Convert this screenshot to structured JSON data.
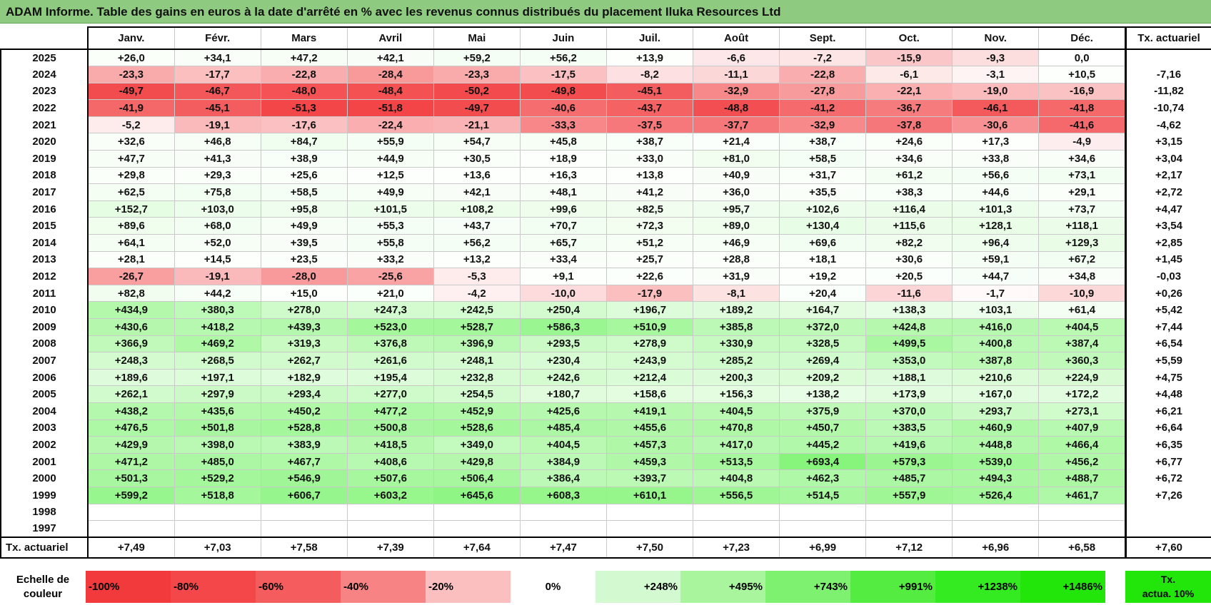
{
  "title": "ADAM Informe. Table des gains en euros à la date d'arrêté en % avec les revenus connus distribués du placement Iluka Resources Ltd",
  "months": [
    "Janv.",
    "Févr.",
    "Mars",
    "Avril",
    "Mai",
    "Juin",
    "Juil.",
    "Août",
    "Sept.",
    "Oct.",
    "Nov.",
    "Déc."
  ],
  "side_header": "Tx. actuariel",
  "rows": [
    {
      "year": "2025",
      "values": [
        "+26,0",
        "+34,1",
        "+47,2",
        "+42,1",
        "+59,2",
        "+56,2",
        "+13,9",
        "-6,6",
        "-7,2",
        "-15,9",
        "-9,3",
        "0,0"
      ],
      "rate": ""
    },
    {
      "year": "2024",
      "values": [
        "-23,3",
        "-17,7",
        "-22,8",
        "-28,4",
        "-23,3",
        "-17,5",
        "-8,2",
        "-11,1",
        "-22,8",
        "-6,1",
        "-3,1",
        "+10,5"
      ],
      "rate": "-7,16"
    },
    {
      "year": "2023",
      "values": [
        "-49,7",
        "-46,7",
        "-48,0",
        "-48,4",
        "-50,2",
        "-49,8",
        "-45,1",
        "-32,9",
        "-27,8",
        "-22,1",
        "-19,0",
        "-16,9"
      ],
      "rate": "-11,82"
    },
    {
      "year": "2022",
      "values": [
        "-41,9",
        "-45,1",
        "-51,3",
        "-51,8",
        "-49,7",
        "-40,6",
        "-43,7",
        "-48,8",
        "-41,2",
        "-36,7",
        "-46,1",
        "-41,8"
      ],
      "rate": "-10,74"
    },
    {
      "year": "2021",
      "values": [
        "-5,2",
        "-19,1",
        "-17,6",
        "-22,4",
        "-21,1",
        "-33,3",
        "-37,5",
        "-37,7",
        "-32,9",
        "-37,8",
        "-30,6",
        "-41,6"
      ],
      "rate": "-4,62"
    },
    {
      "year": "2020",
      "values": [
        "+32,6",
        "+46,8",
        "+84,7",
        "+55,9",
        "+54,7",
        "+45,8",
        "+38,7",
        "+21,4",
        "+38,7",
        "+24,6",
        "+17,3",
        "-4,9"
      ],
      "rate": "+3,15"
    },
    {
      "year": "2019",
      "values": [
        "+47,7",
        "+41,3",
        "+38,9",
        "+44,9",
        "+30,5",
        "+18,9",
        "+33,0",
        "+81,0",
        "+58,5",
        "+34,6",
        "+33,8",
        "+34,6"
      ],
      "rate": "+3,04"
    },
    {
      "year": "2018",
      "values": [
        "+29,8",
        "+29,3",
        "+25,6",
        "+12,5",
        "+13,6",
        "+16,3",
        "+13,8",
        "+40,9",
        "+31,7",
        "+61,2",
        "+56,6",
        "+73,1"
      ],
      "rate": "+2,17"
    },
    {
      "year": "2017",
      "values": [
        "+62,5",
        "+75,8",
        "+58,5",
        "+49,9",
        "+42,1",
        "+48,1",
        "+41,2",
        "+36,0",
        "+35,5",
        "+38,3",
        "+44,6",
        "+29,1"
      ],
      "rate": "+2,72"
    },
    {
      "year": "2016",
      "values": [
        "+152,7",
        "+103,0",
        "+95,8",
        "+101,5",
        "+108,2",
        "+99,6",
        "+82,5",
        "+95,7",
        "+102,6",
        "+116,4",
        "+101,3",
        "+73,7"
      ],
      "rate": "+4,47"
    },
    {
      "year": "2015",
      "values": [
        "+89,6",
        "+68,0",
        "+49,9",
        "+55,3",
        "+43,7",
        "+70,7",
        "+72,3",
        "+89,0",
        "+130,4",
        "+115,6",
        "+128,1",
        "+118,1"
      ],
      "rate": "+3,54"
    },
    {
      "year": "2014",
      "values": [
        "+64,1",
        "+52,0",
        "+39,5",
        "+55,8",
        "+56,2",
        "+65,7",
        "+51,2",
        "+46,9",
        "+69,6",
        "+82,2",
        "+96,4",
        "+129,3"
      ],
      "rate": "+2,85"
    },
    {
      "year": "2013",
      "values": [
        "+28,1",
        "+14,5",
        "+23,5",
        "+33,2",
        "+13,2",
        "+33,4",
        "+25,7",
        "+28,8",
        "+18,1",
        "+30,6",
        "+59,1",
        "+67,2"
      ],
      "rate": "+1,45"
    },
    {
      "year": "2012",
      "values": [
        "-26,7",
        "-19,1",
        "-28,0",
        "-25,6",
        "-5,3",
        "+9,1",
        "+22,6",
        "+31,9",
        "+19,2",
        "+20,5",
        "+44,7",
        "+34,8"
      ],
      "rate": "-0,03"
    },
    {
      "year": "2011",
      "values": [
        "+82,8",
        "+44,2",
        "+15,0",
        "+21,0",
        "-4,2",
        "-10,0",
        "-17,9",
        "-8,1",
        "+20,4",
        "-11,6",
        "-1,7",
        "-10,9"
      ],
      "rate": "+0,26"
    },
    {
      "year": "2010",
      "values": [
        "+434,9",
        "+380,3",
        "+278,0",
        "+247,3",
        "+242,5",
        "+250,4",
        "+196,7",
        "+189,2",
        "+164,7",
        "+138,3",
        "+103,1",
        "+61,4"
      ],
      "rate": "+5,42"
    },
    {
      "year": "2009",
      "values": [
        "+430,6",
        "+418,2",
        "+439,3",
        "+523,0",
        "+528,7",
        "+586,3",
        "+510,9",
        "+385,8",
        "+372,0",
        "+424,8",
        "+416,0",
        "+404,5"
      ],
      "rate": "+7,44"
    },
    {
      "year": "2008",
      "values": [
        "+366,9",
        "+469,2",
        "+319,3",
        "+376,8",
        "+396,9",
        "+293,5",
        "+278,9",
        "+330,9",
        "+328,5",
        "+499,5",
        "+400,8",
        "+387,4"
      ],
      "rate": "+6,54"
    },
    {
      "year": "2007",
      "values": [
        "+248,3",
        "+268,5",
        "+262,7",
        "+261,6",
        "+248,1",
        "+230,4",
        "+243,9",
        "+285,2",
        "+269,4",
        "+353,0",
        "+387,8",
        "+360,3"
      ],
      "rate": "+5,59"
    },
    {
      "year": "2006",
      "values": [
        "+189,6",
        "+197,1",
        "+182,9",
        "+195,4",
        "+232,8",
        "+242,6",
        "+212,4",
        "+200,3",
        "+209,2",
        "+188,1",
        "+210,6",
        "+224,9"
      ],
      "rate": "+4,75"
    },
    {
      "year": "2005",
      "values": [
        "+262,1",
        "+297,9",
        "+293,4",
        "+277,0",
        "+254,5",
        "+180,7",
        "+158,6",
        "+156,3",
        "+138,2",
        "+173,9",
        "+167,0",
        "+172,2"
      ],
      "rate": "+4,48"
    },
    {
      "year": "2004",
      "values": [
        "+438,2",
        "+435,6",
        "+450,2",
        "+477,2",
        "+452,9",
        "+425,6",
        "+419,1",
        "+404,5",
        "+375,9",
        "+370,0",
        "+293,7",
        "+273,1"
      ],
      "rate": "+6,21"
    },
    {
      "year": "2003",
      "values": [
        "+476,5",
        "+501,8",
        "+528,8",
        "+500,8",
        "+528,6",
        "+485,4",
        "+455,6",
        "+470,8",
        "+450,7",
        "+383,5",
        "+460,9",
        "+407,9"
      ],
      "rate": "+6,64"
    },
    {
      "year": "2002",
      "values": [
        "+429,9",
        "+398,0",
        "+383,9",
        "+418,5",
        "+349,0",
        "+404,5",
        "+457,3",
        "+417,0",
        "+445,2",
        "+419,6",
        "+448,8",
        "+466,4"
      ],
      "rate": "+6,35"
    },
    {
      "year": "2001",
      "values": [
        "+471,2",
        "+485,0",
        "+467,7",
        "+408,6",
        "+429,8",
        "+384,9",
        "+459,3",
        "+513,5",
        "+693,4",
        "+579,3",
        "+539,0",
        "+456,2"
      ],
      "rate": "+6,77"
    },
    {
      "year": "2000",
      "values": [
        "+501,3",
        "+529,2",
        "+546,9",
        "+507,6",
        "+506,4",
        "+386,4",
        "+393,7",
        "+404,8",
        "+462,3",
        "+485,7",
        "+494,3",
        "+488,7"
      ],
      "rate": "+6,72"
    },
    {
      "year": "1999",
      "values": [
        "+599,2",
        "+518,8",
        "+606,7",
        "+603,2",
        "+645,6",
        "+608,3",
        "+610,1",
        "+556,5",
        "+514,5",
        "+557,9",
        "+526,4",
        "+461,7"
      ],
      "rate": "+7,26"
    },
    {
      "year": "1998",
      "values": [
        "",
        "",
        "",
        "",
        "",
        "",
        "",
        "",
        "",
        "",
        "",
        ""
      ],
      "rate": ""
    },
    {
      "year": "1997",
      "values": [
        "",
        "",
        "",
        "",
        "",
        "",
        "",
        "",
        "",
        "",
        "",
        ""
      ],
      "rate": ""
    }
  ],
  "totals": {
    "label": "Tx. actuariel",
    "values": [
      "+7,49",
      "+7,03",
      "+7,58",
      "+7,39",
      "+7,64",
      "+7,47",
      "+7,50",
      "+7,23",
      "+6,99",
      "+7,12",
      "+6,96",
      "+6,58"
    ],
    "rate": "+7,60"
  },
  "legend": {
    "label_line1": "Echelle de",
    "label_line2": "couleur",
    "items": [
      {
        "label": "-100%",
        "color": "#f2393c"
      },
      {
        "label": "-80%",
        "color": "#f3474a"
      },
      {
        "label": "-60%",
        "color": "#f55c5e"
      },
      {
        "label": "-40%",
        "color": "#f78385"
      },
      {
        "label": "-20%",
        "color": "#fbbfc0"
      },
      {
        "label": "0%",
        "color": "#ffffff"
      },
      {
        "label": "+248%",
        "color": "#d2f9cf"
      },
      {
        "label": "+495%",
        "color": "#a8f59e"
      },
      {
        "label": "+743%",
        "color": "#7ef170"
      },
      {
        "label": "+991%",
        "color": "#55ec42"
      },
      {
        "label": "+1238%",
        "color": "#34ea20"
      },
      {
        "label": "+1486%",
        "color": "#22e60a"
      }
    ],
    "actua_line1": "Tx.",
    "actua_line2": "actua. 10%",
    "actua_color": "#22e60a"
  }
}
